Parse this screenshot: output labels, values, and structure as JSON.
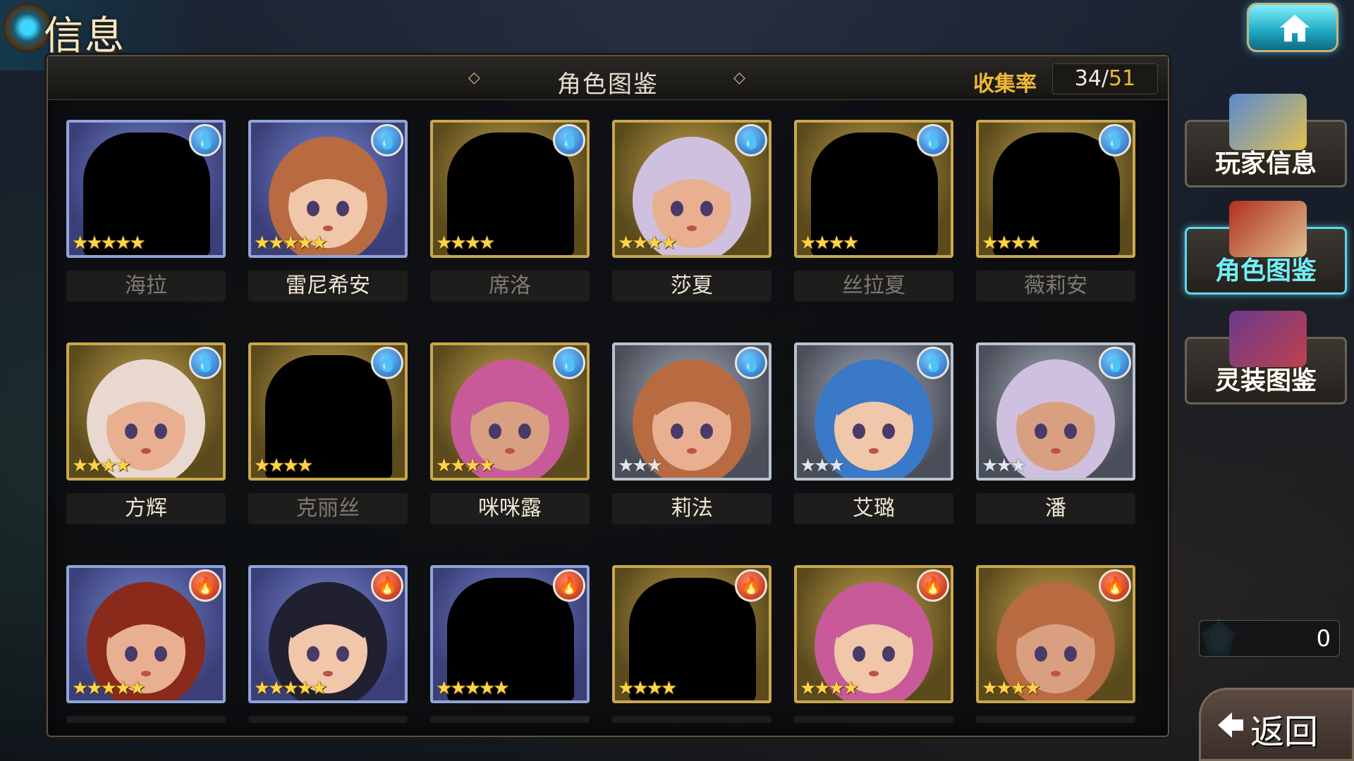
{
  "header": {
    "title": "信息"
  },
  "panel": {
    "title": "角色图鉴",
    "collect_label": "收集率",
    "collect_have": "34",
    "collect_sep": "/",
    "collect_total": "51"
  },
  "side_menu": [
    {
      "label": "玩家信息",
      "icon": "player-info-icon",
      "active": false
    },
    {
      "label": "角色图鉴",
      "icon": "character-book-icon",
      "active": true
    },
    {
      "label": "灵装图鉴",
      "icon": "spirit-gear-book-icon",
      "active": false
    }
  ],
  "currency": {
    "value": "0",
    "icon": "crystal-gem-icon"
  },
  "back_button": {
    "label": "返回"
  },
  "colors": {
    "accent": "#f2b833",
    "active_tab": "#5ed6ea",
    "water": "#1e63b8",
    "fire": "#b52010"
  },
  "characters": [
    {
      "name": "海拉",
      "element": "water",
      "stars": 5,
      "owned": false,
      "frame": "blue"
    },
    {
      "name": "雷尼希安",
      "element": "water",
      "stars": 5,
      "owned": true,
      "frame": "blue"
    },
    {
      "name": "席洛",
      "element": "water",
      "stars": 4,
      "owned": false,
      "frame": "gold"
    },
    {
      "name": "莎夏",
      "element": "water",
      "stars": 4,
      "owned": true,
      "frame": "gold"
    },
    {
      "name": "丝拉夏",
      "element": "water",
      "stars": 4,
      "owned": false,
      "frame": "gold"
    },
    {
      "name": "薇莉安",
      "element": "water",
      "stars": 4,
      "owned": false,
      "frame": "gold"
    },
    {
      "name": "方辉",
      "element": "water",
      "stars": 4,
      "owned": true,
      "frame": "gold"
    },
    {
      "name": "克丽丝",
      "element": "water",
      "stars": 4,
      "owned": false,
      "frame": "gold"
    },
    {
      "name": "咪咪露",
      "element": "water",
      "stars": 4,
      "owned": true,
      "frame": "gold"
    },
    {
      "name": "莉法",
      "element": "water",
      "stars": 3,
      "owned": true,
      "frame": "silver"
    },
    {
      "name": "艾璐",
      "element": "water",
      "stars": 3,
      "owned": true,
      "frame": "silver"
    },
    {
      "name": "潘",
      "element": "water",
      "stars": 3,
      "owned": true,
      "frame": "silver"
    },
    {
      "name": "",
      "element": "fire",
      "stars": 5,
      "owned": true,
      "frame": "blue"
    },
    {
      "name": "",
      "element": "fire",
      "stars": 5,
      "owned": true,
      "frame": "blue"
    },
    {
      "name": "",
      "element": "fire",
      "stars": 5,
      "owned": false,
      "frame": "blue"
    },
    {
      "name": "",
      "element": "fire",
      "stars": 4,
      "owned": false,
      "frame": "gold"
    },
    {
      "name": "",
      "element": "fire",
      "stars": 4,
      "owned": true,
      "frame": "gold"
    },
    {
      "name": "",
      "element": "fire",
      "stars": 4,
      "owned": true,
      "frame": "gold"
    }
  ]
}
